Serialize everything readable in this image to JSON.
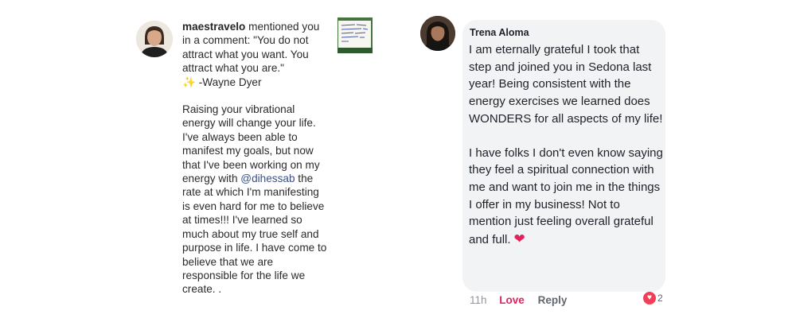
{
  "instagram": {
    "username": "maestravelo",
    "mention_text": " mentioned you in a comment: \"You do not attract what you want. You attract what you are.\"",
    "sparkle_icon": "sparkle-icon",
    "quote_author": " -Wayne Dyer",
    "paragraph_before_mention": "Raising your vibrational energy will change your life. I've always been able to manifest my goals, but now that I've been working on my energy with",
    "mentioned_user": "@dihessab",
    "paragraph_after_mention": " the rate at which I'm manifesting is even hard for me to believe at times!!! I've learned so much about my true self and purpose in life. I have come to believe that we are responsible for the life we create. ."
  },
  "facebook": {
    "commenter_name": "Trena Aloma",
    "paragraph_1": "I am eternally grateful I took that step and joined you in Sedona last year!  Being consistent with the energy exercises we learned does WONDERS for all aspects of my life!",
    "paragraph_2": "I have folks I don't even know saying they feel a spiritual connection with me and want to join me in the things I offer in my business!  Not to mention just feeling overall grateful and full.",
    "time": "11h",
    "love_label": "Love",
    "reply_label": "Reply",
    "reaction_count": "2",
    "bubble_color": "#f2f3f5",
    "love_color": "#e0245e"
  }
}
